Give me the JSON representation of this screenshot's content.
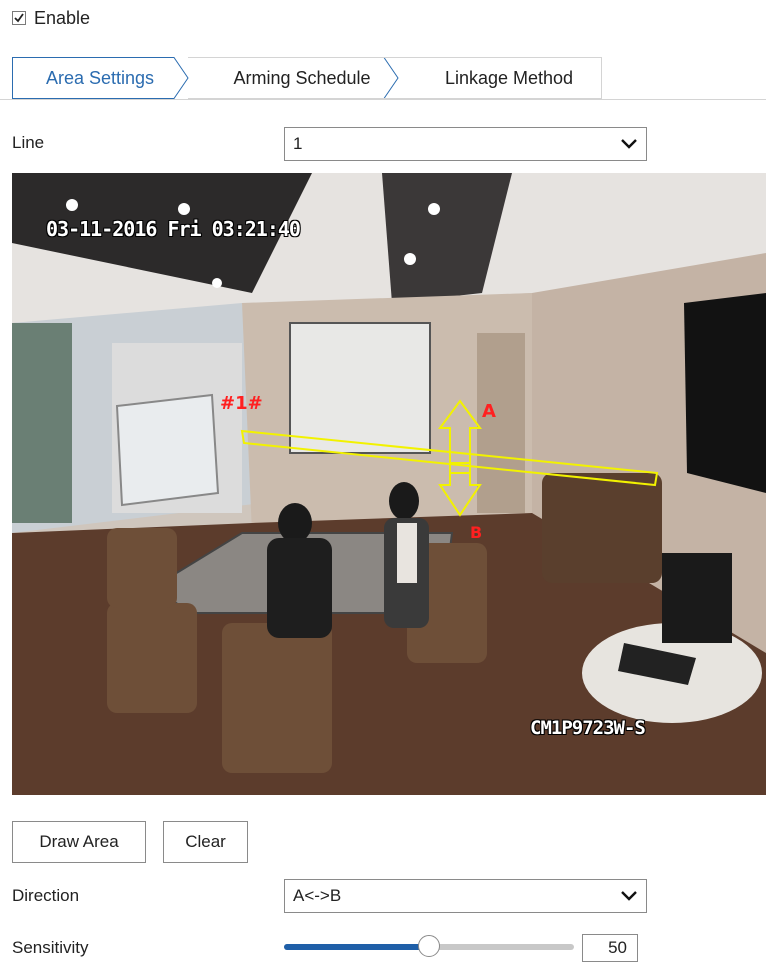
{
  "enable": {
    "label": "Enable",
    "checked": true
  },
  "tabs": [
    {
      "label": "Area Settings",
      "active": true
    },
    {
      "label": "Arming Schedule",
      "active": false
    },
    {
      "label": "Linkage Method",
      "active": false
    }
  ],
  "line": {
    "label": "Line",
    "value": "1"
  },
  "video": {
    "timestamp": "03-11-2016 Fri 03:21:40",
    "camera_name": "CM1P9723W-S",
    "line_label": "#1#",
    "side_a": "A",
    "side_b": "B"
  },
  "buttons": {
    "draw_area": "Draw Area",
    "clear": "Clear"
  },
  "direction": {
    "label": "Direction",
    "value": "A<->B"
  },
  "sensitivity": {
    "label": "Sensitivity",
    "value": "50",
    "level": 0.5
  },
  "colors": {
    "accent": "#1f5fa8",
    "tab_active_text": "#2b6cb0",
    "line_overlay": "#f2f200",
    "osd_red": "#ff2020"
  }
}
